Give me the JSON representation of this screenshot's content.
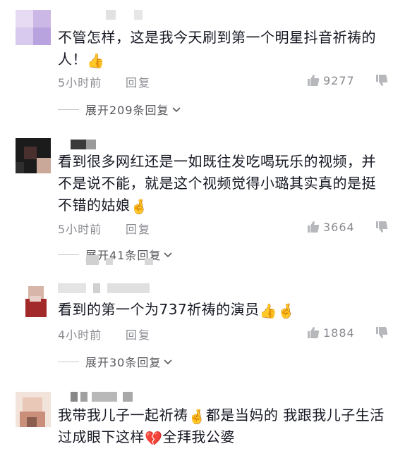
{
  "comments": [
    {
      "text": "不管怎样，这是我今天刷到第一个明星抖音祈祷的人！",
      "emoji": "👍",
      "time": "5小时前",
      "reply_label": "回复",
      "likes": "9277",
      "expand": "展开209条回复",
      "avatar_colors": [
        "#e6dbf3",
        "#cbb8e6",
        "#b9a3de"
      ]
    },
    {
      "text": "看到很多网红还是一如既往发吃喝玩乐的视频，并不是说不能，就是这个视频觉得小璐其实真的是挺不错的姑娘",
      "emoji": "🤞",
      "time": "5小时前",
      "reply_label": "回复",
      "likes": "3664",
      "expand": "展开41条回复",
      "avatar_colors": [
        "#1b1b1b",
        "#4a2f2f",
        "#c9a89a"
      ]
    },
    {
      "text": "看到的第一个为737祈祷的演员",
      "emoji": "👍🤞",
      "time": "4小时前",
      "reply_label": "回复",
      "likes": "1884",
      "expand": "展开30条回复",
      "avatar_colors": [
        "#d7b5a8",
        "#a22a2a",
        "#e8d0c8"
      ]
    },
    {
      "text": "我带我儿子一起祈祷",
      "emoji": "🤞",
      "text_b": "都是当妈的 我跟我儿子生活过成眼下这样",
      "emoji_b": "💔",
      "text_c": "全拜我公婆",
      "avatar_colors": [
        "#e9c8b8",
        "#c98f7a",
        "#8a5d4e"
      ]
    }
  ],
  "colors": {
    "text": "#161823",
    "meta": "#8a8b91",
    "expand": "#58595e"
  },
  "icons": {
    "like": "thumbs-up-icon",
    "dislike": "thumbs-down-icon",
    "chevron": "chevron-down-icon"
  }
}
